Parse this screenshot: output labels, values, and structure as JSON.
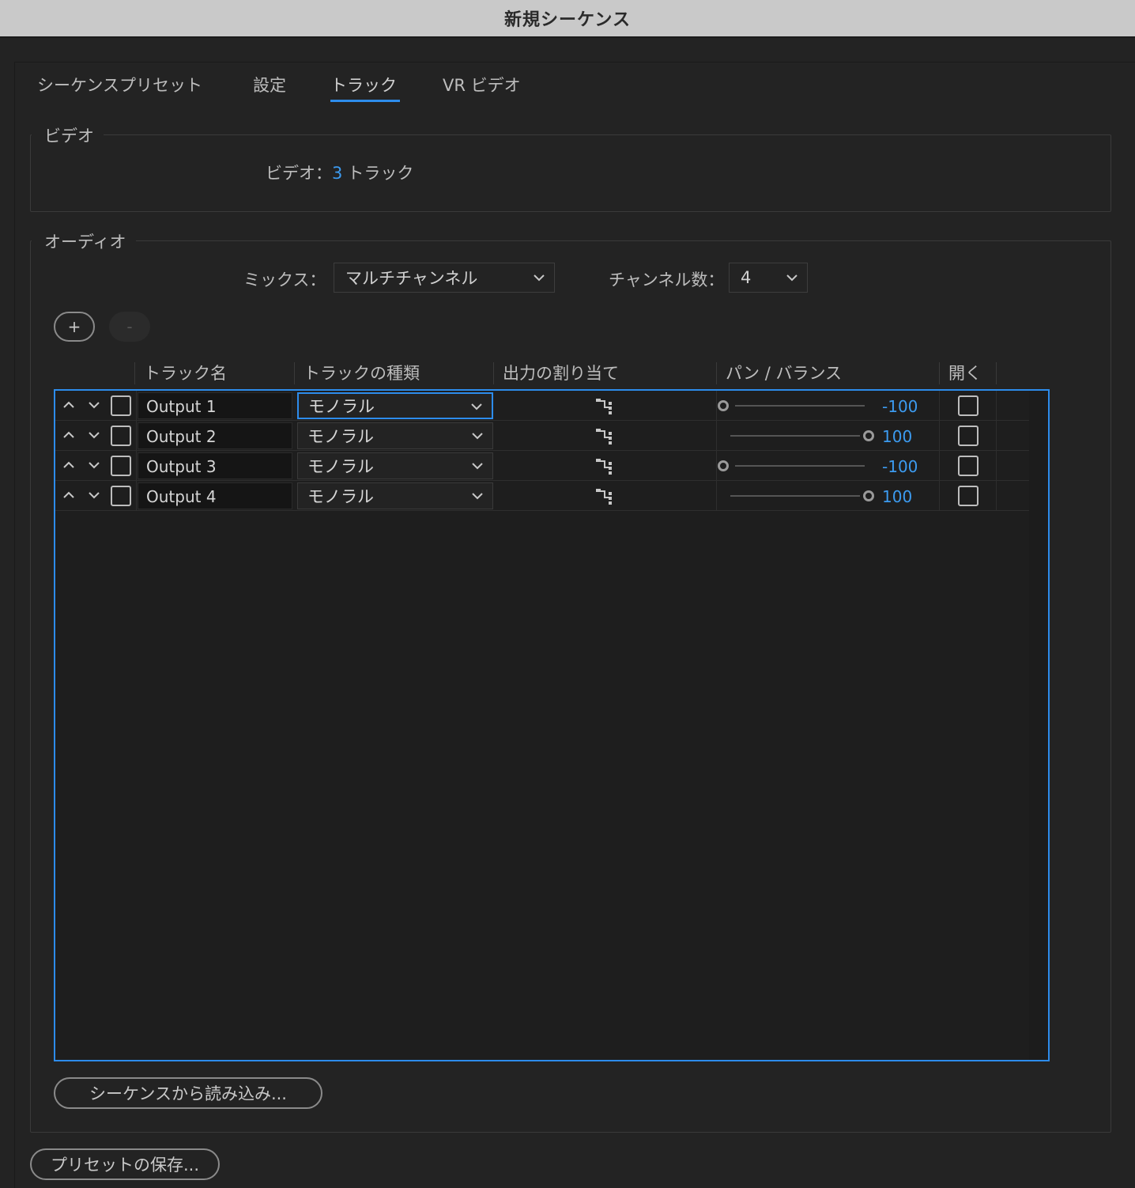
{
  "window": {
    "title": "新規シーケンス"
  },
  "tabs": [
    {
      "label": "シーケンスプリセット",
      "active": false
    },
    {
      "label": "設定",
      "active": false
    },
    {
      "label": "トラック",
      "active": true
    },
    {
      "label": "VR ビデオ",
      "active": false
    }
  ],
  "video": {
    "group_label": "ビデオ",
    "label": "ビデオ：",
    "track_count": "3",
    "track_unit": "トラック"
  },
  "audio": {
    "group_label": "オーディオ",
    "mix_label": "ミックス：",
    "mix_value": "マルチチャンネル",
    "channels_label": "チャンネル数：",
    "channels_value": "4",
    "add_label": "+",
    "remove_label": "-",
    "columns": {
      "track_name": "トラック名",
      "track_type": "トラックの種類",
      "output_assign": "出力の割り当て",
      "pan_balance": "パン / バランス",
      "open": "開く"
    },
    "tracks": [
      {
        "name": "Output 1",
        "type": "モノラル",
        "pan": "-100",
        "pan_fraction": 0.0,
        "open": false
      },
      {
        "name": "Output 2",
        "type": "モノラル",
        "pan": "100",
        "pan_fraction": 1.0,
        "open": false
      },
      {
        "name": "Output 3",
        "type": "モノラル",
        "pan": "-100",
        "pan_fraction": 0.0,
        "open": false
      },
      {
        "name": "Output 4",
        "type": "モノラル",
        "pan": "100",
        "pan_fraction": 1.0,
        "open": false
      }
    ],
    "import_button": "シーケンスから読み込み..."
  },
  "save_preset_button": "プリセットの保存...",
  "colors": {
    "accent": "#2d8ceb",
    "value_blue": "#3c9bf0",
    "background": "#232323",
    "titlebar": "#c9c9c9"
  }
}
